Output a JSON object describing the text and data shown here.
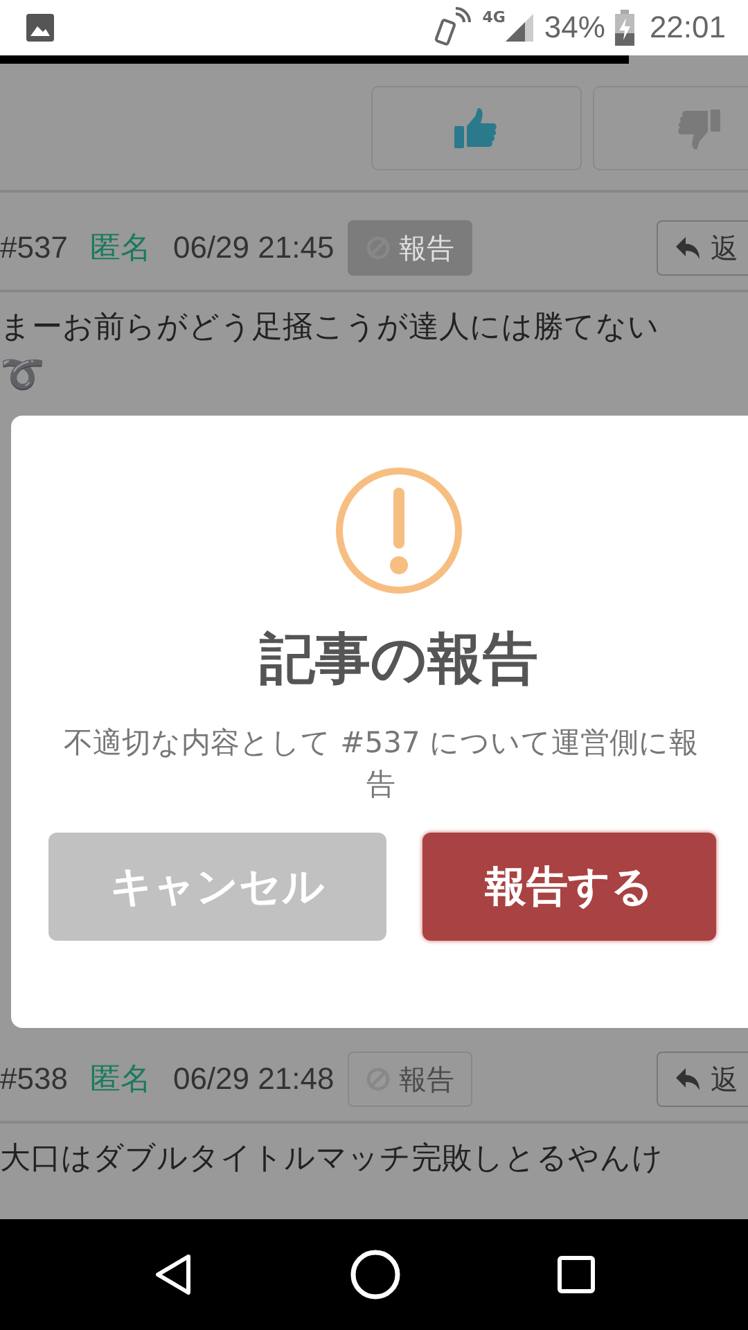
{
  "status_bar": {
    "network": "4G",
    "battery": "34%",
    "time": "22:01"
  },
  "page_progress": {
    "level": 0.84
  },
  "votes": [
    {
      "kind": "up",
      "selected": true
    },
    {
      "kind": "down",
      "selected": false
    }
  ],
  "posts": [
    {
      "number": "#537",
      "author": "匿名",
      "date": "06/29 21:45",
      "report_label": "報告",
      "report_selected": true,
      "reply_label": "返",
      "body": "まーお前らがどう足掻こうが達人には勝てない",
      "emoji": "➰"
    },
    {
      "number": "#538",
      "author": "匿名",
      "date": "06/29 21:48",
      "report_label": "報告",
      "report_selected": false,
      "reply_label": "返",
      "body": "大口はダブルタイトルマッチ完敗しとるやんけ"
    }
  ],
  "dialog": {
    "title": "記事の報告",
    "message": "不適切な内容として #537 について運営側に報告",
    "cancel": "キャンセル",
    "confirm": "報告する"
  }
}
